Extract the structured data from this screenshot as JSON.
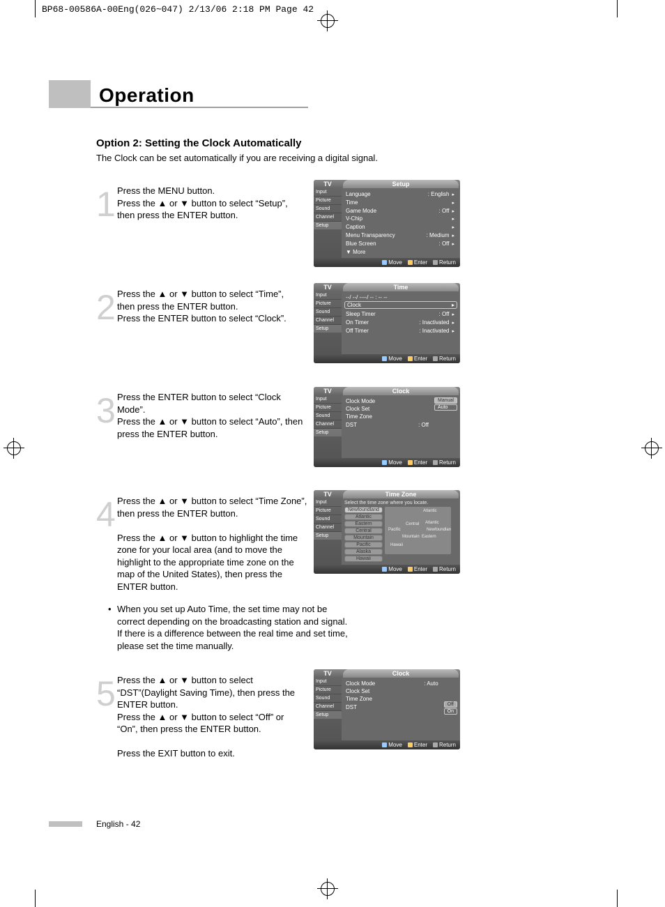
{
  "meta": {
    "slug": "BP68-00586A-00Eng(026~047)  2/13/06  2:18 PM  Page 42"
  },
  "header": {
    "title": "Operation"
  },
  "section": {
    "heading": "Option 2: Setting the Clock Automatically",
    "subtitle": "The Clock can be set automatically if you are receiving a digital signal."
  },
  "steps": [
    {
      "num": "1",
      "text": "Press the MENU button.\nPress the ▲ or ▼ button to select “Setup”, then press the ENTER button."
    },
    {
      "num": "2",
      "text": "Press the ▲ or ▼ button to select “Time”, then press the ENTER button.\nPress the ENTER button to select “Clock”."
    },
    {
      "num": "3",
      "text": "Press the ENTER button to select “Clock Mode”.\nPress the ▲ or ▼ button to select “Auto”, then press the ENTER button."
    },
    {
      "num": "4",
      "text": "Press the ▲ or ▼ button to select “Time Zone”, then press the ENTER button.\n\nPress the ▲ or ▼ button to highlight the time zone for your local area (and to move the highlight to the appropriate time zone on the map of the United States), then press the ENTER button.",
      "note": "When you set up Auto Time, the set time may not be correct depending on the broadcasting station and signal. If there is a difference between the real time and set time, please set the time manually."
    },
    {
      "num": "5",
      "text": "Press the ▲ or ▼ button to select “DST”(Daylight Saving Time), then press the ENTER button.\nPress the ▲ or ▼ button to select “Off” or “On”, then press the ENTER button.\n\nPress the EXIT button to exit."
    }
  ],
  "osd": {
    "common": {
      "tv": "TV",
      "side": [
        "Input",
        "Picture",
        "Sound",
        "Channel",
        "Setup"
      ],
      "footer": [
        "Move",
        "Enter",
        "Return"
      ]
    },
    "0": {
      "title": "Setup",
      "items": [
        {
          "k": "Language",
          "v": ": English"
        },
        {
          "k": "Time"
        },
        {
          "k": "Game Mode",
          "v": ": Off"
        },
        {
          "k": "V-Chip"
        },
        {
          "k": "Caption"
        },
        {
          "k": "Menu Transparency",
          "v": ": Medium"
        },
        {
          "k": "Blue Screen",
          "v": ": Off"
        },
        {
          "k": "▼ More"
        }
      ]
    },
    "1": {
      "title": "Time",
      "datestr": "--/ --/ ----/ -- : -- --",
      "items": [
        {
          "k": "Clock"
        },
        {
          "k": "Sleep Timer",
          "v": ": Off"
        },
        {
          "k": "On Timer",
          "v": ": Inactivated"
        },
        {
          "k": "Off Timer",
          "v": ": Inactivated"
        }
      ]
    },
    "2": {
      "title": "Clock",
      "items": [
        {
          "k": "Clock Mode"
        },
        {
          "k": "Clock Set"
        },
        {
          "k": "Time Zone"
        },
        {
          "k": "DST",
          "v": ": Off"
        }
      ],
      "options": [
        "Manual",
        "Auto"
      ]
    },
    "3": {
      "title": "Time Zone",
      "hint": "Select the time zone where you locate.",
      "zones": [
        "Newfoundland",
        "Atlantic",
        "Eastern",
        "Central",
        "Mountain",
        "Pacific",
        "Alaska",
        "Hawaii"
      ],
      "maplabels": [
        "Atlantic",
        "Pacific",
        "Central",
        "Atlantic",
        "Newfoundland",
        "Eastern",
        "Mountain",
        "Hawaii"
      ]
    },
    "4": {
      "title": "Clock",
      "items": [
        {
          "k": "Clock Mode",
          "v": ": Auto"
        },
        {
          "k": "Clock Set"
        },
        {
          "k": "Time Zone"
        },
        {
          "k": "DST"
        }
      ],
      "options": [
        "Off",
        "On"
      ]
    }
  },
  "footer": "English - 42"
}
